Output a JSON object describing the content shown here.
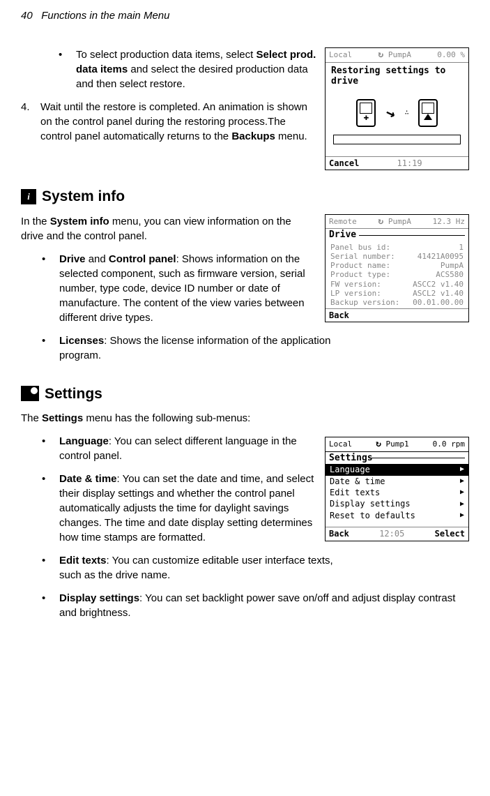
{
  "header": {
    "page_number": "40",
    "chapter": "Functions in the main Menu"
  },
  "body": {
    "bullet1": {
      "text_a": "To select production data items, select ",
      "bold_a": "Select prod. data items",
      "text_b": " and select the desired production data and then select restore."
    },
    "step4": {
      "num": "4.",
      "text_a": "Wait until the restore is completed. An animation is shown on the control panel during the restoring process.The control panel automatically returns to the ",
      "bold_a": "Backups",
      "text_b": " menu."
    },
    "systeminfo": {
      "heading": "System info",
      "intro_a": "In the ",
      "intro_bold": "System info",
      "intro_b": " menu, you can view information on the drive and the control panel.",
      "b1_bold_a": "Drive",
      "b1_mid": " and ",
      "b1_bold_b": "Control panel",
      "b1_text": ": Shows information on the selected component, such as firmware version, serial number, type code, device ID number or date of manufacture. The content of the view varies between different drive types.",
      "b2_bold": "Licenses",
      "b2_text": ": Shows the license information of the application program."
    },
    "settings": {
      "heading": "Settings",
      "intro_a": "The ",
      "intro_bold": "Settings",
      "intro_b": " menu has the following sub-menus:",
      "b1_bold": "Language",
      "b1_text": ": You can select different language in the control panel.",
      "b2_bold": "Date & time",
      "b2_text": ": You can set the date and time, and select their display settings and whether the control panel automatically adjusts the time for daylight savings changes. The time and date display setting determines how time stamps are formatted.",
      "b3_bold": "Edit texts",
      "b3_text": ": You can customize editable user interface texts, such as the drive name.",
      "b4_bold": "Display settings",
      "b4_text": ": You can set backlight power save on/off and adjust display contrast and brightness."
    }
  },
  "screens": {
    "restore": {
      "status_left": "Local",
      "status_mid": "PumpA",
      "status_right": "0.00 %",
      "title": "Restoring settings to drive",
      "footer_left": "Cancel",
      "footer_mid": "11:19"
    },
    "drive": {
      "status_left": "Remote",
      "status_mid": "PumpA",
      "status_right": "12.3 Hz",
      "section": "Drive",
      "rows": [
        {
          "l": "Panel bus id:",
          "r": "1"
        },
        {
          "l": "Serial number:",
          "r": "41421A0095"
        },
        {
          "l": "Product name:",
          "r": "PumpA"
        },
        {
          "l": "Product type:",
          "r": "ACS580"
        },
        {
          "l": "FW version:",
          "r": "ASCC2 v1.40"
        },
        {
          "l": "LP version:",
          "r": "ASCL2 v1.40"
        },
        {
          "l": "Backup version:",
          "r": "00.01.00.00"
        }
      ],
      "footer_left": "Back"
    },
    "settings": {
      "status_left": "Local",
      "status_mid": "Pump1",
      "status_right": "0.0 rpm",
      "section": "Settings",
      "items": [
        {
          "label": "Language",
          "selected": true
        },
        {
          "label": "Date & time",
          "selected": false
        },
        {
          "label": "Edit texts",
          "selected": false
        },
        {
          "label": "Display settings",
          "selected": false
        },
        {
          "label": "Reset to defaults",
          "selected": false
        }
      ],
      "footer_left": "Back",
      "footer_mid": "12:05",
      "footer_right": "Select"
    }
  }
}
